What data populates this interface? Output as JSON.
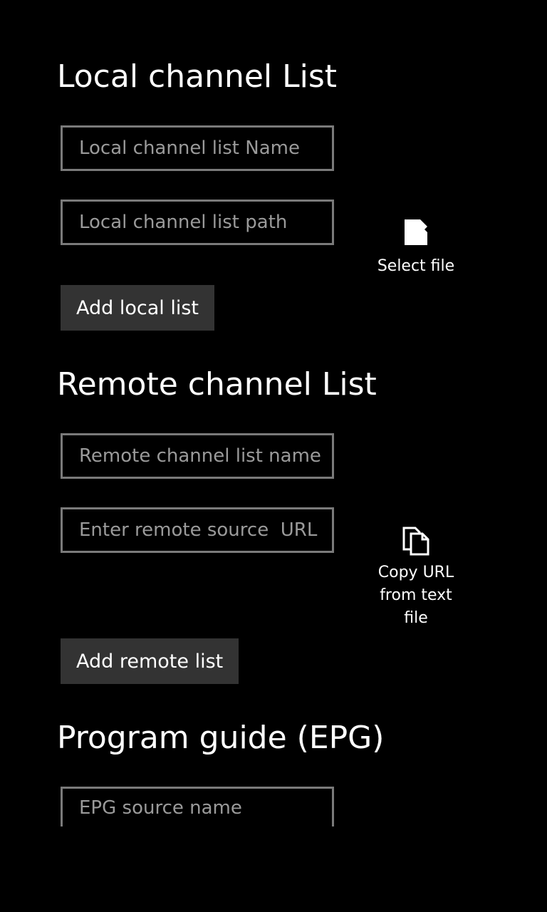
{
  "local_section": {
    "title": "Local channel List",
    "name_placeholder": "Local channel list Name",
    "path_placeholder": "Local channel list path",
    "select_file_label": "Select file",
    "select_file_icon": "sd-card-icon",
    "add_button_label": "Add local list"
  },
  "remote_section": {
    "title": "Remote channel List",
    "name_placeholder": "Remote channel list name",
    "url_placeholder": "Enter remote source  URL",
    "copy_url_label": "Copy URL\nfrom text\nfile",
    "copy_url_icon": "copy-icon",
    "add_button_label": "Add remote list"
  },
  "epg_section": {
    "title": "Program guide (EPG)",
    "source_name_placeholder": "EPG source name"
  },
  "colors": {
    "background": "#000000",
    "text": "#ffffff",
    "input_border": "#7a7a7a",
    "placeholder": "#9a9a9a",
    "button_background": "#333333"
  }
}
